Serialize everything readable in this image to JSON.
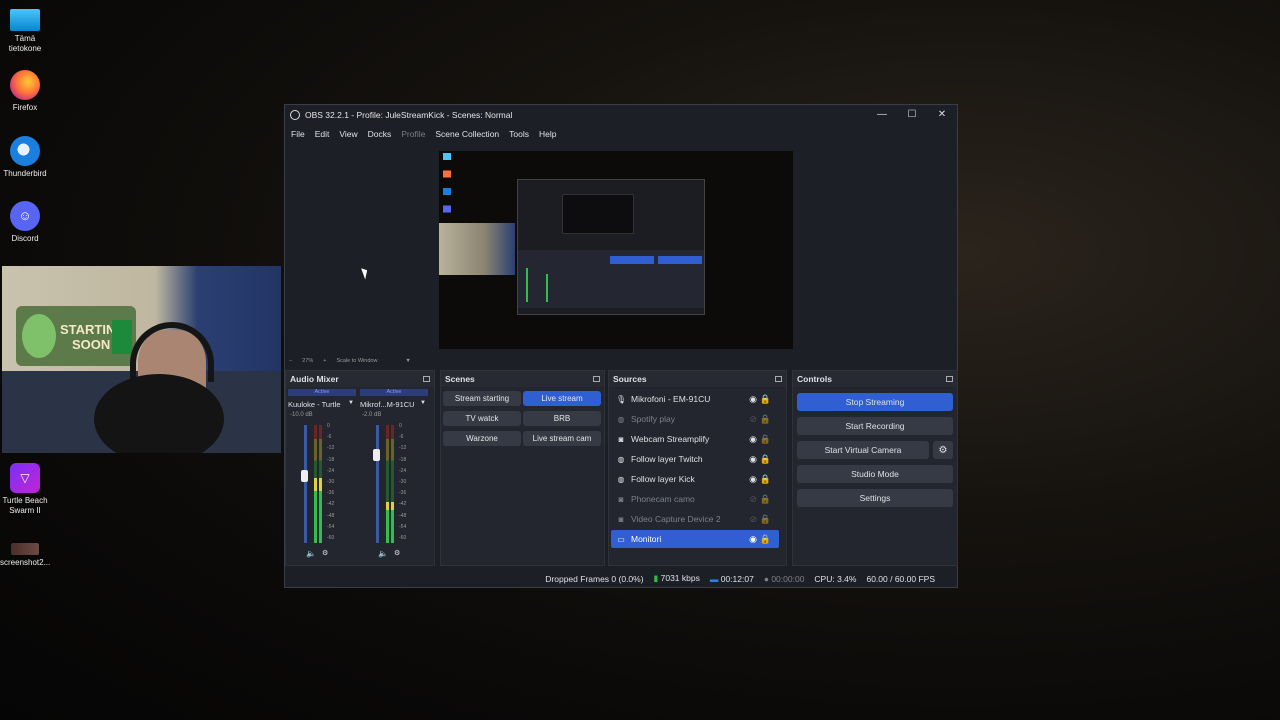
{
  "desktop": {
    "icons": [
      {
        "label": "Tämä tietokone",
        "icon": "computer-icon"
      },
      {
        "label": "Firefox",
        "icon": "firefox-icon"
      },
      {
        "label": "Thunderbird",
        "icon": "thunderbird-icon"
      },
      {
        "label": "Discord",
        "icon": "discord-icon"
      },
      {
        "label": "Turtle Beach Swarm II",
        "icon": "turtle-beach-icon"
      },
      {
        "label": "screenshot2...",
        "icon": "image-file-icon"
      }
    ]
  },
  "webcam": {
    "banner_line1": "STARTING",
    "banner_line2": "SOON"
  },
  "window": {
    "title": "OBS 32.2.1 - Profile: JuleStreamKick - Scenes: Normal",
    "menu": [
      "File",
      "Edit",
      "View",
      "Docks",
      "Profile",
      "Scene Collection",
      "Tools",
      "Help"
    ]
  },
  "preview": {
    "zoom": "27%",
    "zoom_plus": "+",
    "zoom_minus": "−",
    "scale_mode": "Scale to Window"
  },
  "audio_mixer": {
    "title": "Audio Mixer",
    "channels": [
      {
        "status": "Active",
        "name": "Kuuloke - Turtle",
        "db": "-10.0 dB",
        "fader": 0.62,
        "level": 0.55
      },
      {
        "status": "Active",
        "name": "Mikrof...M-91CU",
        "db": "-2.0 dB",
        "fader": 0.8,
        "level": 0.35
      }
    ],
    "scale": [
      "0",
      "-6",
      "-12",
      "-18",
      "-24",
      "-30",
      "-36",
      "-42",
      "-48",
      "-54",
      "-60"
    ]
  },
  "scenes": {
    "title": "Scenes",
    "items": [
      {
        "label": "Stream starting",
        "active": false
      },
      {
        "label": "Live stream",
        "active": true
      },
      {
        "label": "TV watck",
        "active": false
      },
      {
        "label": "BRB",
        "active": false
      },
      {
        "label": "Warzone",
        "active": false
      },
      {
        "label": "Live stream cam",
        "active": false
      }
    ]
  },
  "sources": {
    "title": "Sources",
    "items": [
      {
        "label": "Mikrofoni - EM-91CU",
        "icon": "microphone-icon",
        "visible": true,
        "locked": true,
        "dim": false,
        "selected": false
      },
      {
        "label": "Spotify play",
        "icon": "globe-icon",
        "visible": false,
        "locked": false,
        "dim": true,
        "selected": false
      },
      {
        "label": "Webcam Streamplify",
        "icon": "camera-icon",
        "visible": true,
        "locked": false,
        "dim": false,
        "selected": false
      },
      {
        "label": "Follow layer Twitch",
        "icon": "globe-icon",
        "visible": true,
        "locked": true,
        "dim": false,
        "selected": false
      },
      {
        "label": "Follow layer Kick",
        "icon": "globe-icon",
        "visible": true,
        "locked": true,
        "dim": false,
        "selected": false
      },
      {
        "label": "Phonecam camo",
        "icon": "camera-icon",
        "visible": false,
        "locked": false,
        "dim": true,
        "selected": false
      },
      {
        "label": "Video Capture Device 2",
        "icon": "camera-icon",
        "visible": false,
        "locked": false,
        "dim": true,
        "selected": false
      },
      {
        "label": "Monitori",
        "icon": "monitor-icon",
        "visible": true,
        "locked": true,
        "dim": false,
        "selected": true
      }
    ]
  },
  "controls": {
    "title": "Controls",
    "stop_streaming": "Stop Streaming",
    "start_recording": "Start Recording",
    "start_virtual_camera": "Start Virtual Camera",
    "studio_mode": "Studio Mode",
    "settings": "Settings"
  },
  "status": {
    "dropped_frames": "Dropped Frames 0 (0.0%)",
    "bitrate": "7031 kbps",
    "stream_time": "00:12:07",
    "record_time": "00:00:00",
    "cpu": "CPU: 3.4%",
    "fps": "60.00 / 60.00 FPS"
  },
  "colors": {
    "accent": "#2f5fd0",
    "panel": "#23262e",
    "window": "#1d1f26"
  }
}
